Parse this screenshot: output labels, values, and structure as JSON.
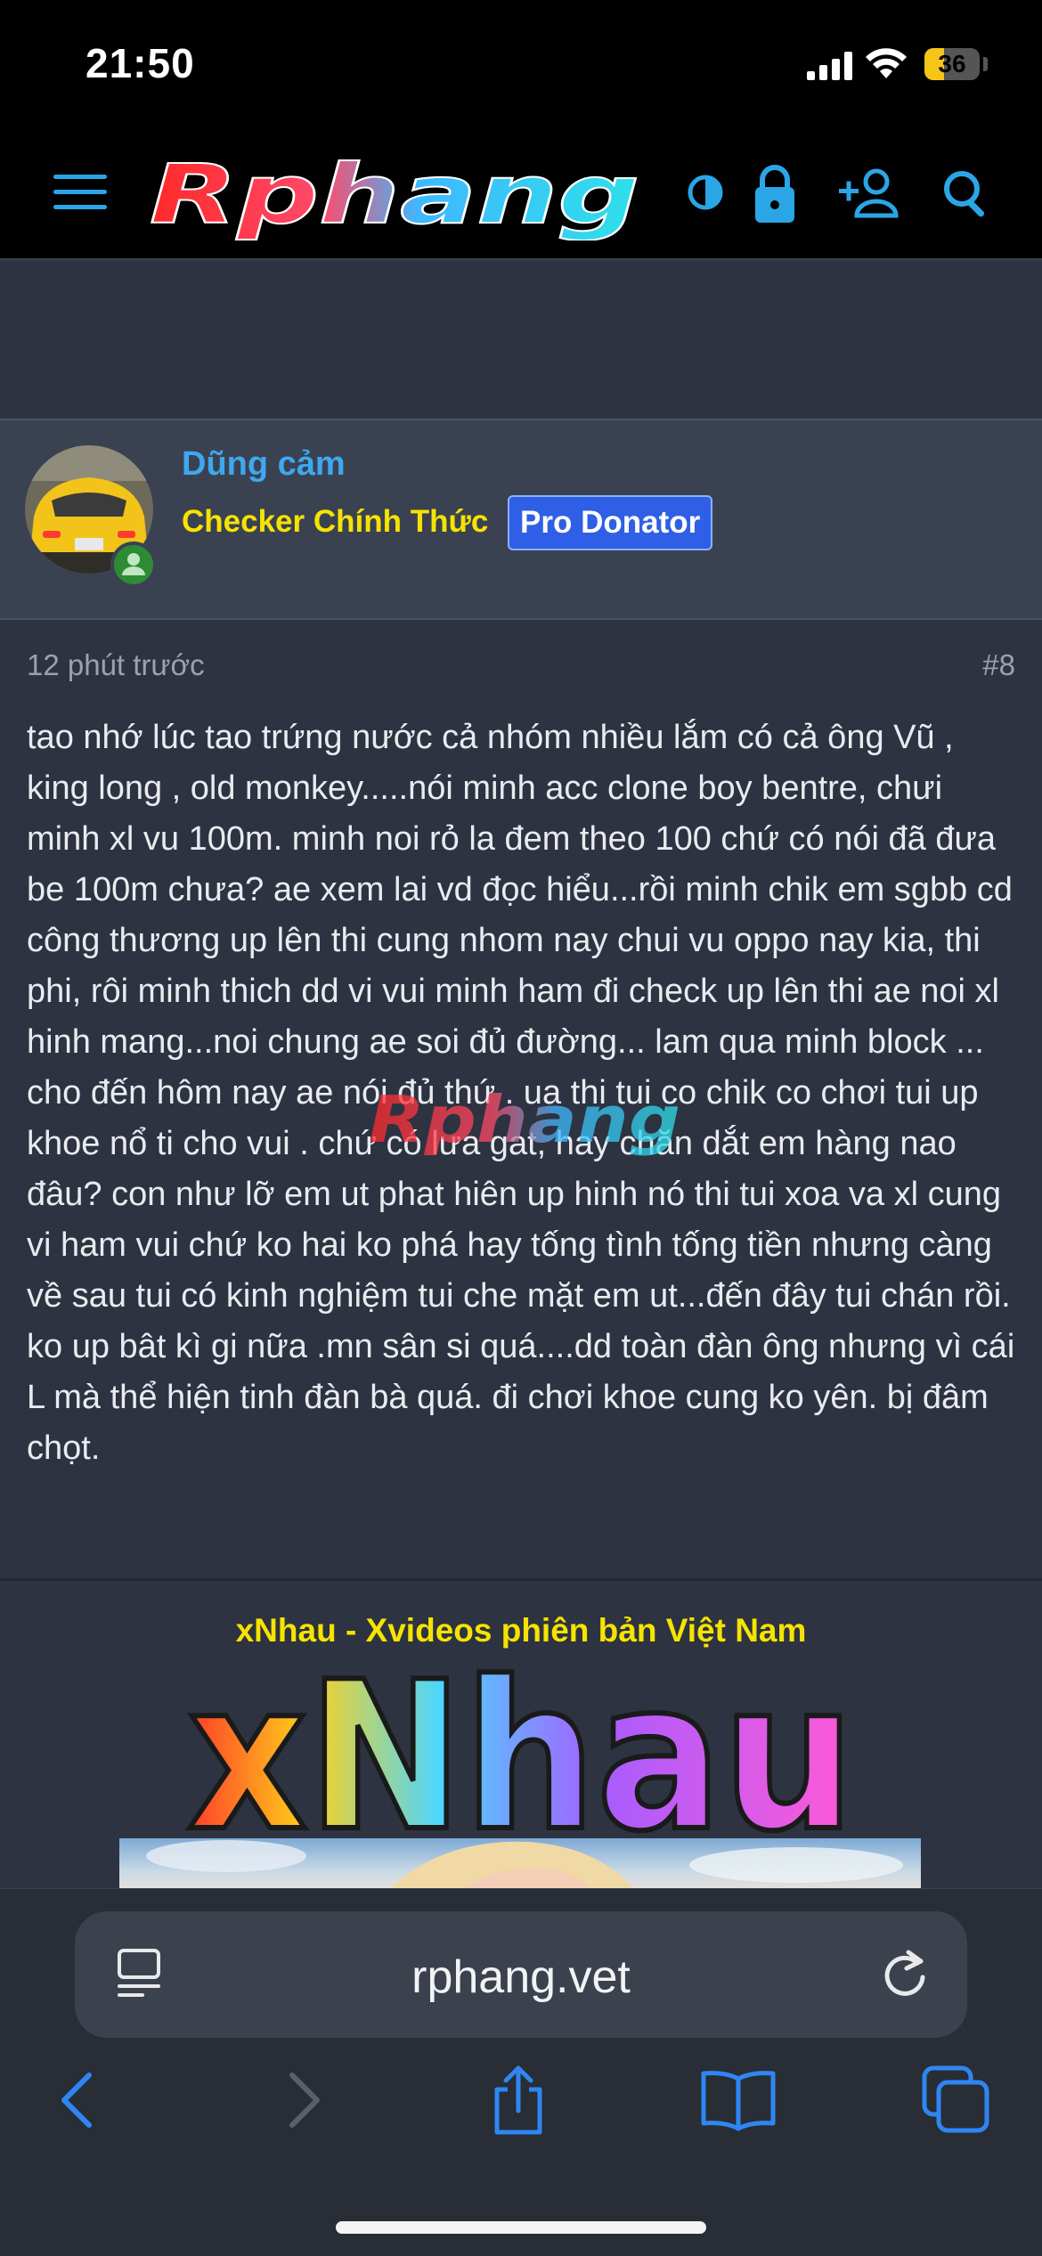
{
  "status": {
    "time": "21:50",
    "battery": "36",
    "battery_level": 0.36
  },
  "header": {
    "logo_text": "Rphang"
  },
  "user": {
    "name": "Dũng cảm",
    "title": "Checker Chính Thức",
    "badge": "Pro Donator"
  },
  "post": {
    "time": "12 phút trước",
    "number": "#8",
    "body": "tao nhớ lúc tao trứng nước cả nhóm nhiều lắm có cả ông Vũ , king long , old monkey.....nói minh acc clone boy bentre, chưi minh xl vu 100m. minh noi rỏ la đem theo 100 chứ có nói đã đưa be 100m chưa? ae xem lai vd đọc hiểu...rồi minh chik em sgbb cd công thương up lên thi cung nhom nay chui vu oppo nay kia, thi phi, rôi minh thich dd vi vui minh ham đi check up lên thi ae noi xl hinh mang...noi chung ae soi đủ đường... lam qua minh block ...\ncho đến hôm nay ae nói đủ thứ . ua thi tui co chik co chơi tui up khoe nổ ti cho vui . chứ có lưa gat, hay chăn dắt em hàng nao đâu? con như lỡ em ut phat hiên up hinh nó thi tui xoa va xl cung vi ham vui chứ ko hai ko phá hay tống tình tống tiền nhưng càng về sau tui có kinh nghiệm tui che mặt em ut...đến đây tui chán rồi. ko up bât kì gi nữa .mn sân si quá....dd toàn đàn ông nhưng vì cái L mà thể hiện tinh đàn bà quá. đi chơi khoe cung ko yên. bị đâm chọt."
  },
  "ad": {
    "title": "xNhau - Xvideos phiên bản Việt Nam",
    "logo_text": "xNhau"
  },
  "browser": {
    "url": "rphang.vet"
  }
}
